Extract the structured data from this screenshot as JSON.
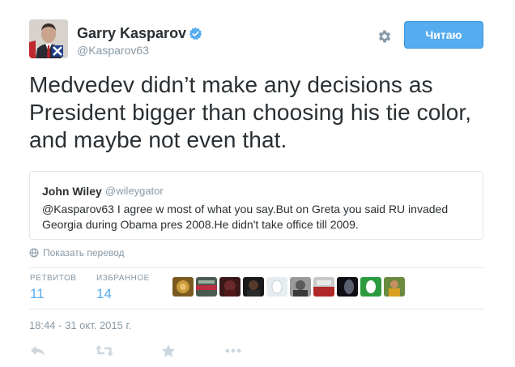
{
  "author": {
    "name": "Garry Kasparov",
    "handle": "@Kasparov63",
    "verified": true
  },
  "follow_button": {
    "label": "Читаю"
  },
  "tweet": {
    "text": "Medvedev didn’t make any decisions as President bigger than choosing his tie color, and maybe not even that."
  },
  "quoted_tweet": {
    "name": "John Wiley",
    "handle": "@wileygator",
    "text": "@Kasparov63  I agree w most of what you say.But on Greta you said RU invaded Georgia during Obama pres 2008.He didn't take office till 2009."
  },
  "translate_link": "Показать перевод",
  "stats": {
    "retweets_label": "РЕТВИТОВ",
    "retweets_value": "11",
    "favorites_label": "ИЗБРАННОЕ",
    "favorites_value": "14"
  },
  "timestamp": "18:44 - 31 окт. 2015 г.",
  "colors": {
    "accent": "#55acee",
    "muted": "#8899a6",
    "text": "#292f33",
    "border": "#e1e8ed"
  },
  "icons": [
    "verified-badge-icon",
    "gear-icon",
    "globe-icon",
    "reply-icon",
    "retweet-icon",
    "favorite-star-icon",
    "more-dots-icon"
  ]
}
